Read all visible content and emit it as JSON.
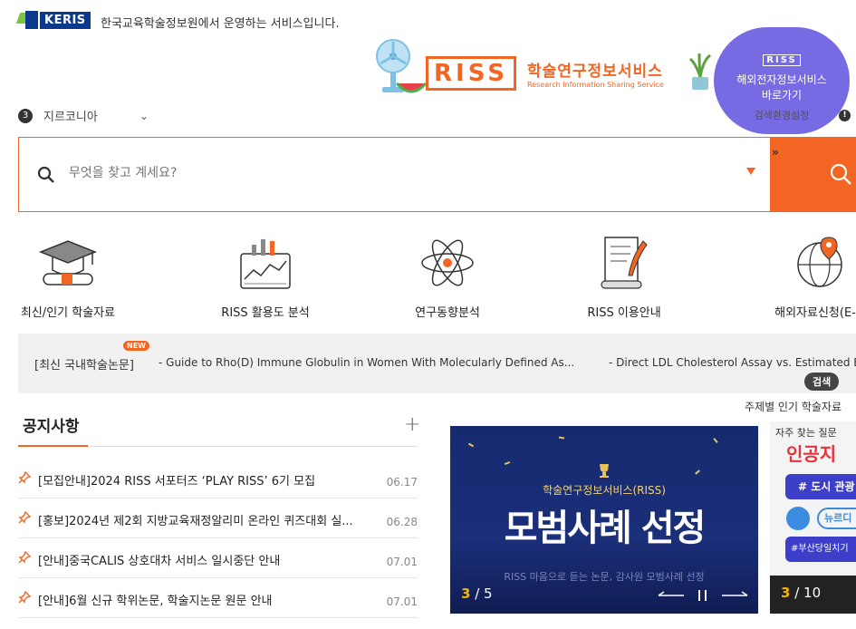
{
  "header": {
    "org_logo": "KERIS",
    "org_text": "한국교육학술정보원에서 운영하는 서비스입니다.",
    "riss_logo": "RISS",
    "riss_title_ko": "학술연구정보서비스",
    "riss_title_en": "Research Information Sharing Service",
    "overseas": {
      "mini_logo": "RISS",
      "line1": "해외전자정보서비스",
      "line2": "바로가기",
      "line3": "검색환경설정"
    }
  },
  "language": {
    "badge": "3",
    "selected": "지르코니아",
    "chevron": "⌄"
  },
  "search": {
    "placeholder": "무엇을 찾고 계세요?",
    "more": "»"
  },
  "quick_menu": [
    {
      "label": "최신/인기 학술자료",
      "icon": "graduation-cap-icon"
    },
    {
      "label": "RISS 활용도 분석",
      "icon": "chart-analysis-icon"
    },
    {
      "label": "연구동향분석",
      "icon": "atom-icon"
    },
    {
      "label": "RISS 이용안내",
      "icon": "document-quill-icon"
    },
    {
      "label": "해외자료신청(E-D",
      "icon": "globe-pin-icon"
    }
  ],
  "latest": {
    "tag": "[최신 국내학술논문]",
    "badge": "NEW",
    "item1": "- Guide to Rho(D) Immune Globulin in Women With Molecularly Defined As...",
    "item2": "- Direct LDL Cholesterol Assay vs. Estimated E",
    "search_btn": "검색"
  },
  "topic_link": "주제별 인기 학술자료",
  "notices": {
    "title": "공지사항",
    "more": "+",
    "items": [
      {
        "text": "[모집안내]2024 RISS 서포터즈 ‘PLAY RISS’ 6기 모집",
        "date": "06.17"
      },
      {
        "text": "[홍보]2024년 제2회 지방교육재정알리미 온라인 퀴즈대회 실...",
        "date": "06.28"
      },
      {
        "text": "[안내]중국CALIS 상호대차 서비스 일시중단 안내",
        "date": "07.01"
      },
      {
        "text": "[안내]6월 신규 학위논문, 학술지논문 원문 안내",
        "date": "07.01"
      }
    ]
  },
  "banner": {
    "sub": "학술연구정보서비스(RISS)",
    "main": "모범사례 선정",
    "desc": "RISS 마음으로 듣는 논문, 감사원 모범사례 선정",
    "current": "3",
    "total": "5"
  },
  "faq": {
    "title": "자주 찾는 질문",
    "big": "인공지",
    "pill1": "# 도시 관광",
    "pill2": "뉴르디",
    "pill3": "#부산당일치기",
    "current": "3",
    "total": "10"
  },
  "colors": {
    "accent": "#f26522",
    "keris_blue": "#0b3a8c",
    "overseas_purple": "#6b5fe0"
  }
}
